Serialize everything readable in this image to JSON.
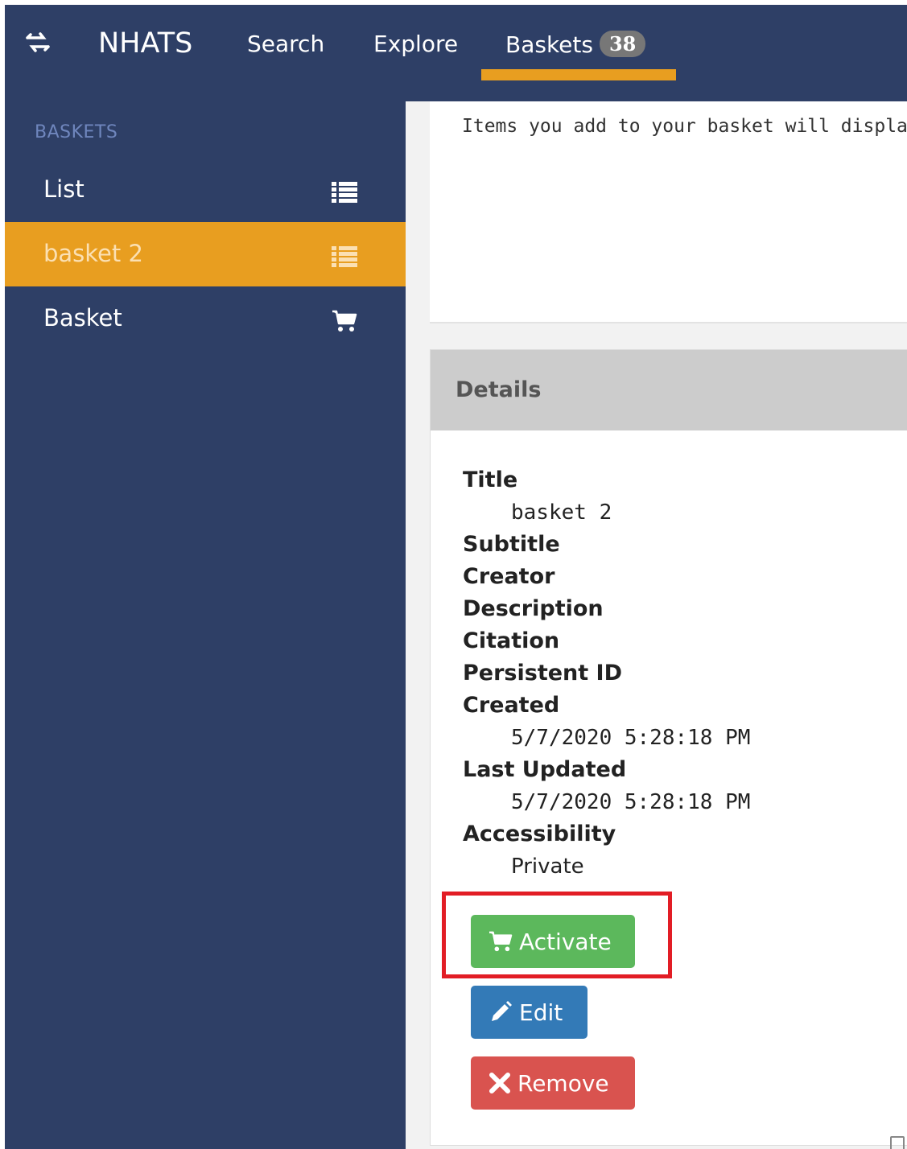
{
  "nav": {
    "brand": "NHATS",
    "links": [
      {
        "label": "Search"
      },
      {
        "label": "Explore"
      },
      {
        "label": "Baskets",
        "badge": "38"
      }
    ],
    "toggle_icon": "exchange-icon"
  },
  "sidebar": {
    "header": "BASKETS",
    "items": [
      {
        "label": "List",
        "icon": "list-icon",
        "active": false
      },
      {
        "label": "basket 2",
        "icon": "list-icon",
        "active": true
      },
      {
        "label": "Basket",
        "icon": "cart-icon",
        "active": false
      }
    ]
  },
  "main": {
    "empty_text": "Items you add to your basket will display here",
    "details": {
      "heading": "Details",
      "fields": [
        {
          "label": "Title",
          "value": "basket 2"
        },
        {
          "label": "Subtitle",
          "value": ""
        },
        {
          "label": "Creator",
          "value": ""
        },
        {
          "label": "Description",
          "value": ""
        },
        {
          "label": "Citation",
          "value": ""
        },
        {
          "label": "Persistent ID",
          "value": ""
        },
        {
          "label": "Created",
          "value": "5/7/2020 5:28:18 PM"
        },
        {
          "label": "Last Updated",
          "value": "5/7/2020 5:28:18 PM"
        },
        {
          "label": "Accessibility",
          "value": "Private"
        }
      ]
    },
    "buttons": {
      "activate": "Activate",
      "edit": "Edit",
      "remove": "Remove"
    }
  },
  "colors": {
    "nav_bg": "#2e3f66",
    "accent": "#e89e20",
    "success": "#5cb85c",
    "primary": "#337ab7",
    "danger": "#d9534f",
    "highlight": "#e21d25"
  }
}
